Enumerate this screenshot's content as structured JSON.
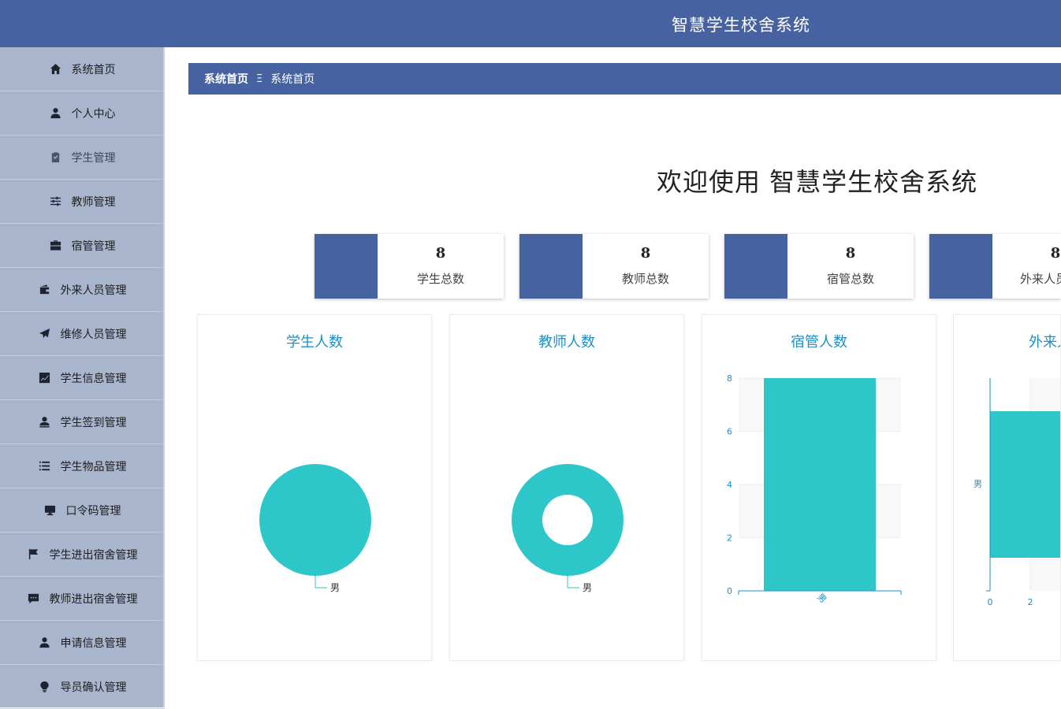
{
  "header": {
    "title": "智慧学生校舍系统"
  },
  "sidebar": {
    "items": [
      {
        "label": "系统首页",
        "icon": "home-icon"
      },
      {
        "label": "个人中心",
        "icon": "user-icon"
      },
      {
        "label": "学生管理",
        "icon": "clipboard-check-icon"
      },
      {
        "label": "教师管理",
        "icon": "sliders-icon"
      },
      {
        "label": "宿管管理",
        "icon": "briefcase-icon"
      },
      {
        "label": "外来人员管理",
        "icon": "wallet-icon"
      },
      {
        "label": "维修人员管理",
        "icon": "paper-plane-icon"
      },
      {
        "label": "学生信息管理",
        "icon": "line-chart-icon"
      },
      {
        "label": "学生签到管理",
        "icon": "user-stamp-icon"
      },
      {
        "label": "学生物品管理",
        "icon": "list-icon"
      },
      {
        "label": "口令码管理",
        "icon": "monitor-icon"
      },
      {
        "label": "学生进出宿舍管理",
        "icon": "flag-icon"
      },
      {
        "label": "教师进出宿舍管理",
        "icon": "message-icon"
      },
      {
        "label": "申请信息管理",
        "icon": "person-icon"
      },
      {
        "label": "导员确认管理",
        "icon": "bulb-icon"
      }
    ]
  },
  "breadcrumb": {
    "home": "系统首页",
    "separator": "Ξ",
    "current": "系统首页"
  },
  "welcome": "欢迎使用 智慧学生校舍系统",
  "stats": [
    {
      "value": "8",
      "label": "学生总数"
    },
    {
      "value": "8",
      "label": "教师总数"
    },
    {
      "value": "8",
      "label": "宿管总数"
    },
    {
      "value": "8",
      "label": "外来人员总数"
    }
  ],
  "colors": {
    "primary": "#4762a0",
    "sidebar": "#a9b5cc",
    "series": "#2ec7c9",
    "chart_title": "#1d8fc7"
  },
  "chart_data": [
    {
      "type": "pie",
      "title": "学生人数",
      "labels": [
        "男"
      ],
      "values": [
        8
      ]
    },
    {
      "type": "pie",
      "title": "教师人数",
      "labels": [
        "男"
      ],
      "values": [
        8
      ],
      "donut": true
    },
    {
      "type": "bar",
      "title": "宿管人数",
      "categories": [
        "男"
      ],
      "values": [
        8
      ],
      "ylim": [
        0,
        8
      ],
      "yticks": [
        0,
        2,
        4,
        6,
        8
      ]
    },
    {
      "type": "bar",
      "title": "外来人员人数",
      "orientation": "horizontal",
      "categories": [
        "男"
      ],
      "values": [
        8
      ],
      "xticks": [
        0,
        2
      ]
    }
  ]
}
